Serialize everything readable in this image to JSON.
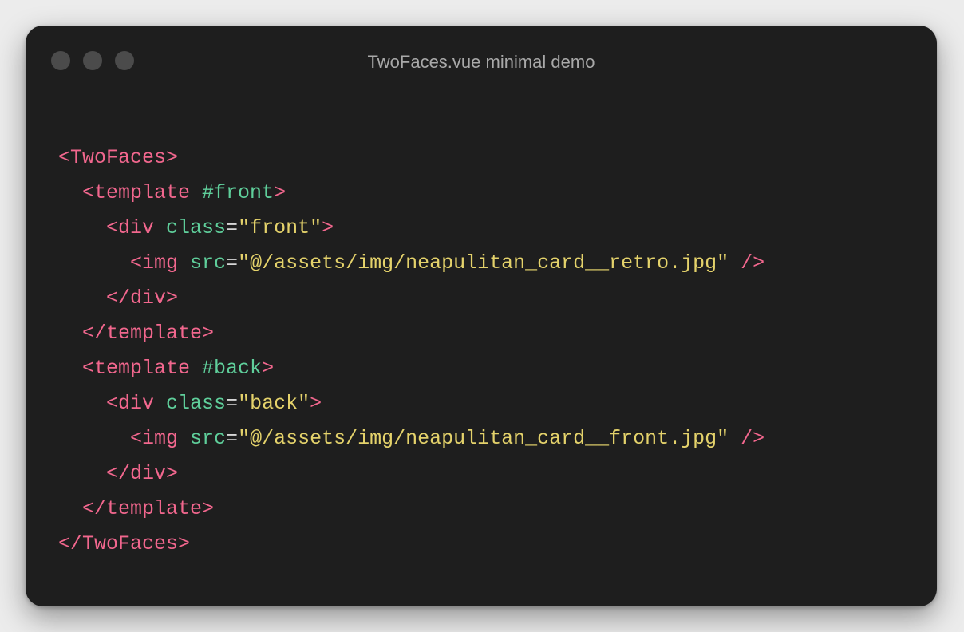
{
  "window": {
    "title": "TwoFaces.vue minimal demo"
  },
  "code": {
    "lines": [
      [
        {
          "t": "<TwoFaces>",
          "c": "tag"
        }
      ],
      [
        {
          "t": "  ",
          "c": "punc"
        },
        {
          "t": "<template ",
          "c": "tag"
        },
        {
          "t": "#front",
          "c": "attr"
        },
        {
          "t": ">",
          "c": "tag"
        }
      ],
      [
        {
          "t": "    ",
          "c": "punc"
        },
        {
          "t": "<div ",
          "c": "tag"
        },
        {
          "t": "class",
          "c": "attr"
        },
        {
          "t": "=",
          "c": "punc"
        },
        {
          "t": "\"front\"",
          "c": "str"
        },
        {
          "t": ">",
          "c": "tag"
        }
      ],
      [
        {
          "t": "      ",
          "c": "punc"
        },
        {
          "t": "<img ",
          "c": "tag"
        },
        {
          "t": "src",
          "c": "attr"
        },
        {
          "t": "=",
          "c": "punc"
        },
        {
          "t": "\"@/assets/img/neapulitan_card__retro.jpg\"",
          "c": "str"
        },
        {
          "t": " />",
          "c": "tag"
        }
      ],
      [
        {
          "t": "    ",
          "c": "punc"
        },
        {
          "t": "</div>",
          "c": "tag"
        }
      ],
      [
        {
          "t": "  ",
          "c": "punc"
        },
        {
          "t": "</template>",
          "c": "tag"
        }
      ],
      [
        {
          "t": "  ",
          "c": "punc"
        },
        {
          "t": "<template ",
          "c": "tag"
        },
        {
          "t": "#back",
          "c": "attr"
        },
        {
          "t": ">",
          "c": "tag"
        }
      ],
      [
        {
          "t": "    ",
          "c": "punc"
        },
        {
          "t": "<div ",
          "c": "tag"
        },
        {
          "t": "class",
          "c": "attr"
        },
        {
          "t": "=",
          "c": "punc"
        },
        {
          "t": "\"back\"",
          "c": "str"
        },
        {
          "t": ">",
          "c": "tag"
        }
      ],
      [
        {
          "t": "      ",
          "c": "punc"
        },
        {
          "t": "<img ",
          "c": "tag"
        },
        {
          "t": "src",
          "c": "attr"
        },
        {
          "t": "=",
          "c": "punc"
        },
        {
          "t": "\"@/assets/img/neapulitan_card__front.jpg\"",
          "c": "str"
        },
        {
          "t": " />",
          "c": "tag"
        }
      ],
      [
        {
          "t": "    ",
          "c": "punc"
        },
        {
          "t": "</div>",
          "c": "tag"
        }
      ],
      [
        {
          "t": "  ",
          "c": "punc"
        },
        {
          "t": "</template>",
          "c": "tag"
        }
      ],
      [
        {
          "t": "</TwoFaces>",
          "c": "tag"
        }
      ]
    ]
  },
  "colors": {
    "tag": "#f2678e",
    "attr": "#5fcf9b",
    "string": "#e4d26b",
    "background": "#1e1e1e"
  }
}
